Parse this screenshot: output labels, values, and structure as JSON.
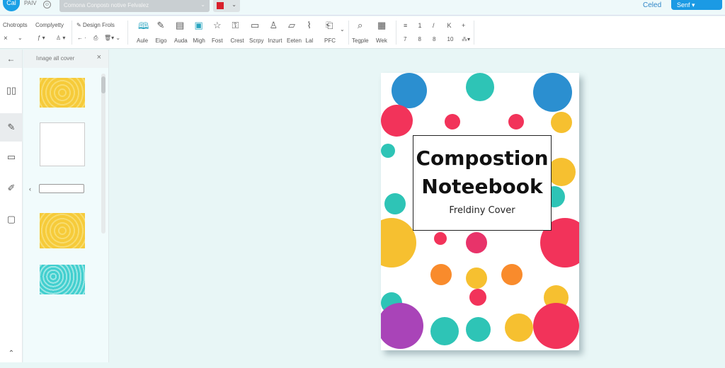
{
  "topbar": {
    "logo": "Cal",
    "app_name": "PAIV",
    "document_name": "Comona Conpostı notive Felvalez",
    "celed_link": "Celed",
    "send_button": "Senf ▾"
  },
  "toolbar": {
    "group1": {
      "labels": [
        "Chotropts",
        "Complyetty"
      ]
    },
    "group2": {
      "label": "Design Frols"
    },
    "tools": [
      {
        "icon": "book-icon",
        "label": "Aule"
      },
      {
        "icon": "pencil-icon",
        "label": "Eigo"
      },
      {
        "icon": "document-icon",
        "label": "Auda"
      },
      {
        "icon": "image-icon",
        "label": "Migh"
      },
      {
        "icon": "star-icon",
        "label": "Fost"
      },
      {
        "icon": "lock-icon",
        "label": "Crest"
      },
      {
        "icon": "screen-icon",
        "label": "Scrpy"
      },
      {
        "icon": "stamp-icon",
        "label": "Inzurt"
      },
      {
        "icon": "picture-icon",
        "label": "Eeten"
      },
      {
        "icon": "paperclip-icon",
        "label": "Lal"
      },
      {
        "icon": "pdf-icon",
        "label": "PFC"
      }
    ],
    "view_tools": [
      {
        "icon": "search-icon",
        "label": "Tegple"
      },
      {
        "icon": "grid-icon",
        "label": "Wek"
      }
    ],
    "format_row1": [
      "≡",
      "1",
      "/",
      "K",
      "+"
    ],
    "format_row2": [
      "7",
      "8",
      "8",
      "10",
      "⁂▾"
    ]
  },
  "panel": {
    "title": "Iınage all cover"
  },
  "cover": {
    "title_line1": "Compostion",
    "title_line2": "Noteebook",
    "subtitle": "Freldiny Cover"
  }
}
